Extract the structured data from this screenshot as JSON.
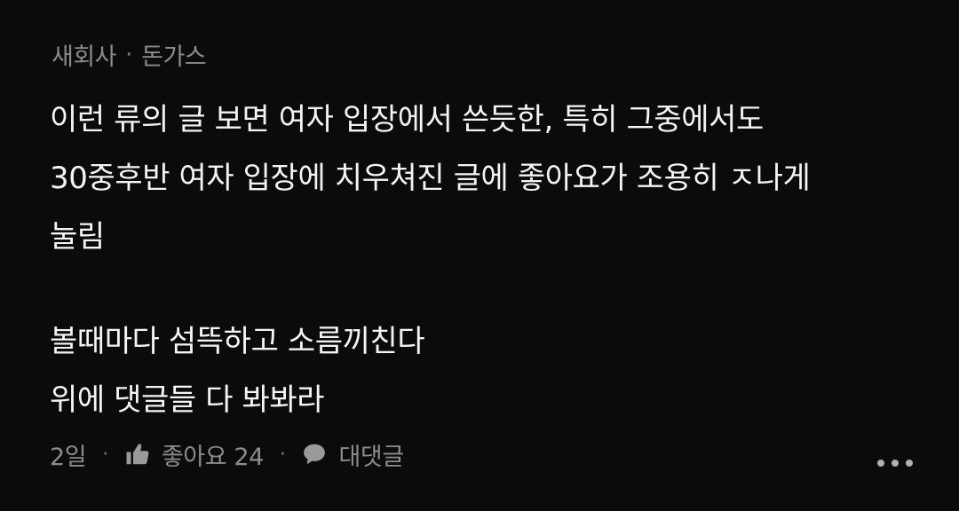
{
  "comment": {
    "author": "새회사",
    "separator": "·",
    "subtitle": "돈가스",
    "lines": [
      "이런 류의 글 보면 여자 입장에서 쓴듯한, 특히 그중에서도",
      "30중후반 여자 입장에 치우쳐진 글에 좋아요가 조용히 ㅈ나게",
      "눌림",
      "볼때마다 섬뜩하고 소름끼친다",
      "위에 댓글들 다 봐봐라"
    ],
    "time": "2일",
    "dot": "·",
    "like_label": "좋아요 24",
    "reply_label": "대댓글",
    "icons": {
      "like": "thumbs-up-icon",
      "reply": "speech-bubble-icon",
      "more": "more-horizontal-icon"
    },
    "colors": {
      "background": "#0b0b0c",
      "text": "#f4f4f4",
      "muted": "#8c8c8c"
    }
  }
}
